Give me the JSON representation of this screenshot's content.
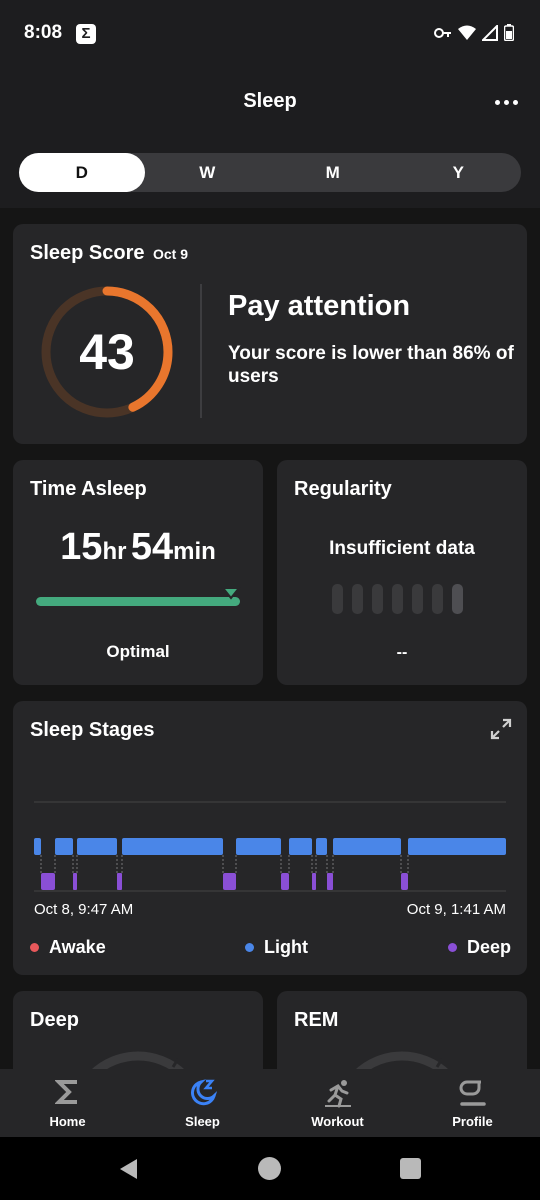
{
  "status": {
    "time": "8:08"
  },
  "header": {
    "title": "Sleep",
    "segments": [
      "D",
      "W",
      "M",
      "Y"
    ],
    "active_segment": "D"
  },
  "score_card": {
    "title": "Sleep Score",
    "date": "Oct 9",
    "score": "43",
    "score_fraction": 0.43,
    "headline": "Pay attention",
    "description": "Your score is lower than 86% of users"
  },
  "time_asleep": {
    "title": "Time Asleep",
    "hours": "15",
    "hours_unit": "hr",
    "minutes": "54",
    "minutes_unit": "min",
    "status": "Optimal"
  },
  "regularity": {
    "title": "Regularity",
    "message": "Insufficient data",
    "value": "--"
  },
  "sleep_stages": {
    "title": "Sleep Stages",
    "start_label": "Oct 8, 9:47 AM",
    "end_label": "Oct 9, 1:41 AM",
    "legend": [
      {
        "label": "Awake",
        "color": "#e8585b"
      },
      {
        "label": "Light",
        "color": "#4a86e8"
      },
      {
        "label": "Deep",
        "color": "#8a4fd6"
      }
    ]
  },
  "bottom_cards": {
    "deep_title": "Deep",
    "rem_title": "REM"
  },
  "tabbar": {
    "items": [
      {
        "label": "Home",
        "icon": "sigma-icon"
      },
      {
        "label": "Sleep",
        "icon": "moon-icon",
        "active": true
      },
      {
        "label": "Workout",
        "icon": "runner-icon"
      },
      {
        "label": "Profile",
        "icon": "profile-icon"
      }
    ]
  },
  "colors": {
    "score_ring": "#e9762d",
    "score_track": "#4a3426",
    "accent_blue": "#3b82f6",
    "bar_green": "#44aa7e"
  }
}
